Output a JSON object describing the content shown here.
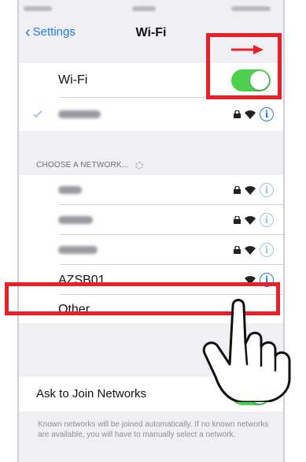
{
  "nav": {
    "back_label": "Settings",
    "title": "Wi-Fi"
  },
  "wifi": {
    "label": "Wi-Fi",
    "enabled": true
  },
  "section_header": "CHOOSE A NETWORK...",
  "networks": [
    {
      "name": "AZSB01",
      "visible": true
    }
  ],
  "other_label": "Other...",
  "ask_to_join": {
    "label": "Ask to Join Networks",
    "enabled": true
  },
  "footer_note": "Known networks will be joined automatically. If no known networks are available, you will have to manually select a network.",
  "colors": {
    "accent": "#1f7cf2",
    "toggle_on": "#4cd04e",
    "highlight": "#e8202a"
  },
  "icons": [
    "chevron-left-icon",
    "lock-icon",
    "wifi-icon",
    "info-icon",
    "right-arrow-icon",
    "pointing-hand-icon",
    "spinner-icon"
  ]
}
